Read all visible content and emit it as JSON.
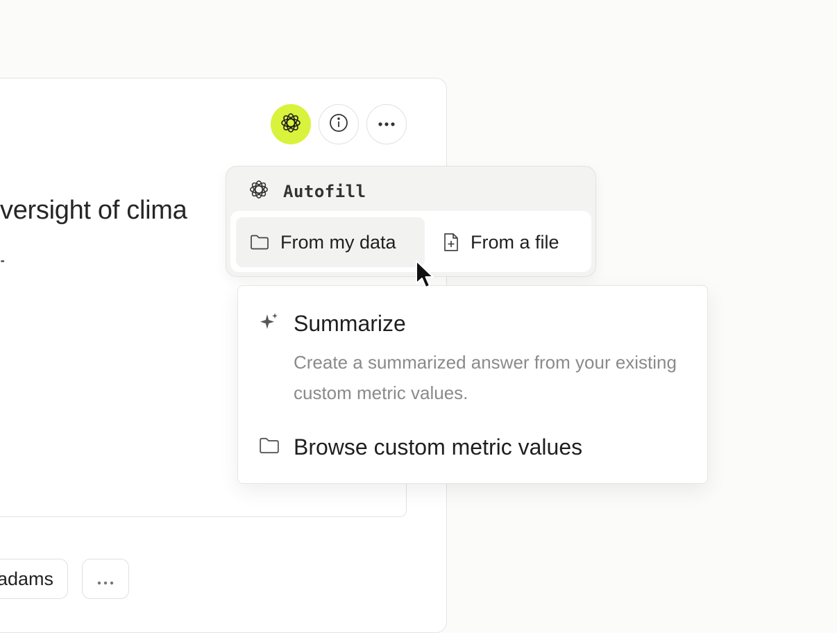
{
  "card": {
    "title_visible": "versight of clima",
    "subtitle_fragment": "-"
  },
  "header_actions": {
    "ai_icon": "ai-flower-icon",
    "info_icon": "info-icon",
    "more_icon": "more-horizontal-icon",
    "accent_color": "#d9f23c"
  },
  "autofill": {
    "label": "Autofill",
    "options": [
      {
        "label": "From my data",
        "icon": "folder-icon"
      },
      {
        "label": "From a file",
        "icon": "file-plus-icon"
      }
    ]
  },
  "submenu": {
    "summarize_label": "Summarize",
    "summarize_desc": "Create a summarized answer from your existing custom metric values.",
    "browse_label": "Browse custom metric values"
  },
  "footer": {
    "user_chip": "adams",
    "more_chip": "···"
  }
}
